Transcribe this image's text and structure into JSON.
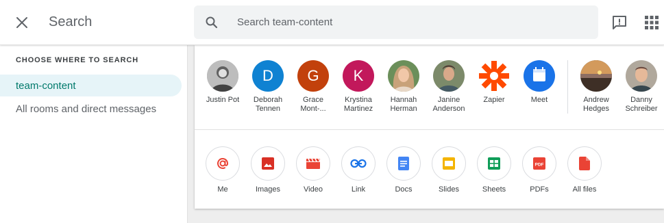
{
  "header": {
    "title": "Search",
    "search_placeholder": "Search team-content"
  },
  "sidebar": {
    "heading": "CHOOSE WHERE TO SEARCH",
    "items": [
      {
        "label": "team-content",
        "active": true
      },
      {
        "label": "All rooms and direct messages",
        "active": false
      }
    ]
  },
  "people": [
    {
      "name": "Justin Pot",
      "avatar": "photo",
      "color": "#9e9e9e"
    },
    {
      "name": "Deborah\nTennen",
      "avatar": "D",
      "color": "#0f82d2"
    },
    {
      "name": "Grace\nMont-...",
      "avatar": "G",
      "color": "#c2410c"
    },
    {
      "name": "Krystina\nMartinez",
      "avatar": "K",
      "color": "#c2185b"
    },
    {
      "name": "Hannah\nHerman",
      "avatar": "photo",
      "color": "#c8a27a"
    },
    {
      "name": "Janine\nAnderson",
      "avatar": "photo",
      "color": "#6d7a5c"
    },
    {
      "name": "Zapier",
      "avatar": "zapier-logo",
      "color": "#ff4a00"
    },
    {
      "name": "Meet",
      "avatar": "meet-logo",
      "color": "#1a73e8"
    },
    {
      "name": "Andrew\nHedges",
      "avatar": "photo",
      "color": "#5d4a3a"
    },
    {
      "name": "Danny\nSchreiber",
      "avatar": "photo",
      "color": "#a1887f"
    }
  ],
  "filters": [
    {
      "label": "Me",
      "icon": "at-icon",
      "color": "#ea4335"
    },
    {
      "label": "Images",
      "icon": "image-icon",
      "color": "#d93025"
    },
    {
      "label": "Video",
      "icon": "video-icon",
      "color": "#ea4335"
    },
    {
      "label": "Link",
      "icon": "link-icon",
      "color": "#1a73e8"
    },
    {
      "label": "Docs",
      "icon": "docs-icon",
      "color": "#4285f4"
    },
    {
      "label": "Slides",
      "icon": "slides-icon",
      "color": "#f4b400"
    },
    {
      "label": "Sheets",
      "icon": "sheets-icon",
      "color": "#0f9d58"
    },
    {
      "label": "PDFs",
      "icon": "pdf-icon",
      "color": "#ea4335"
    },
    {
      "label": "All files",
      "icon": "file-icon",
      "color": "#ea4335"
    }
  ],
  "pdf_badge": "PDF"
}
